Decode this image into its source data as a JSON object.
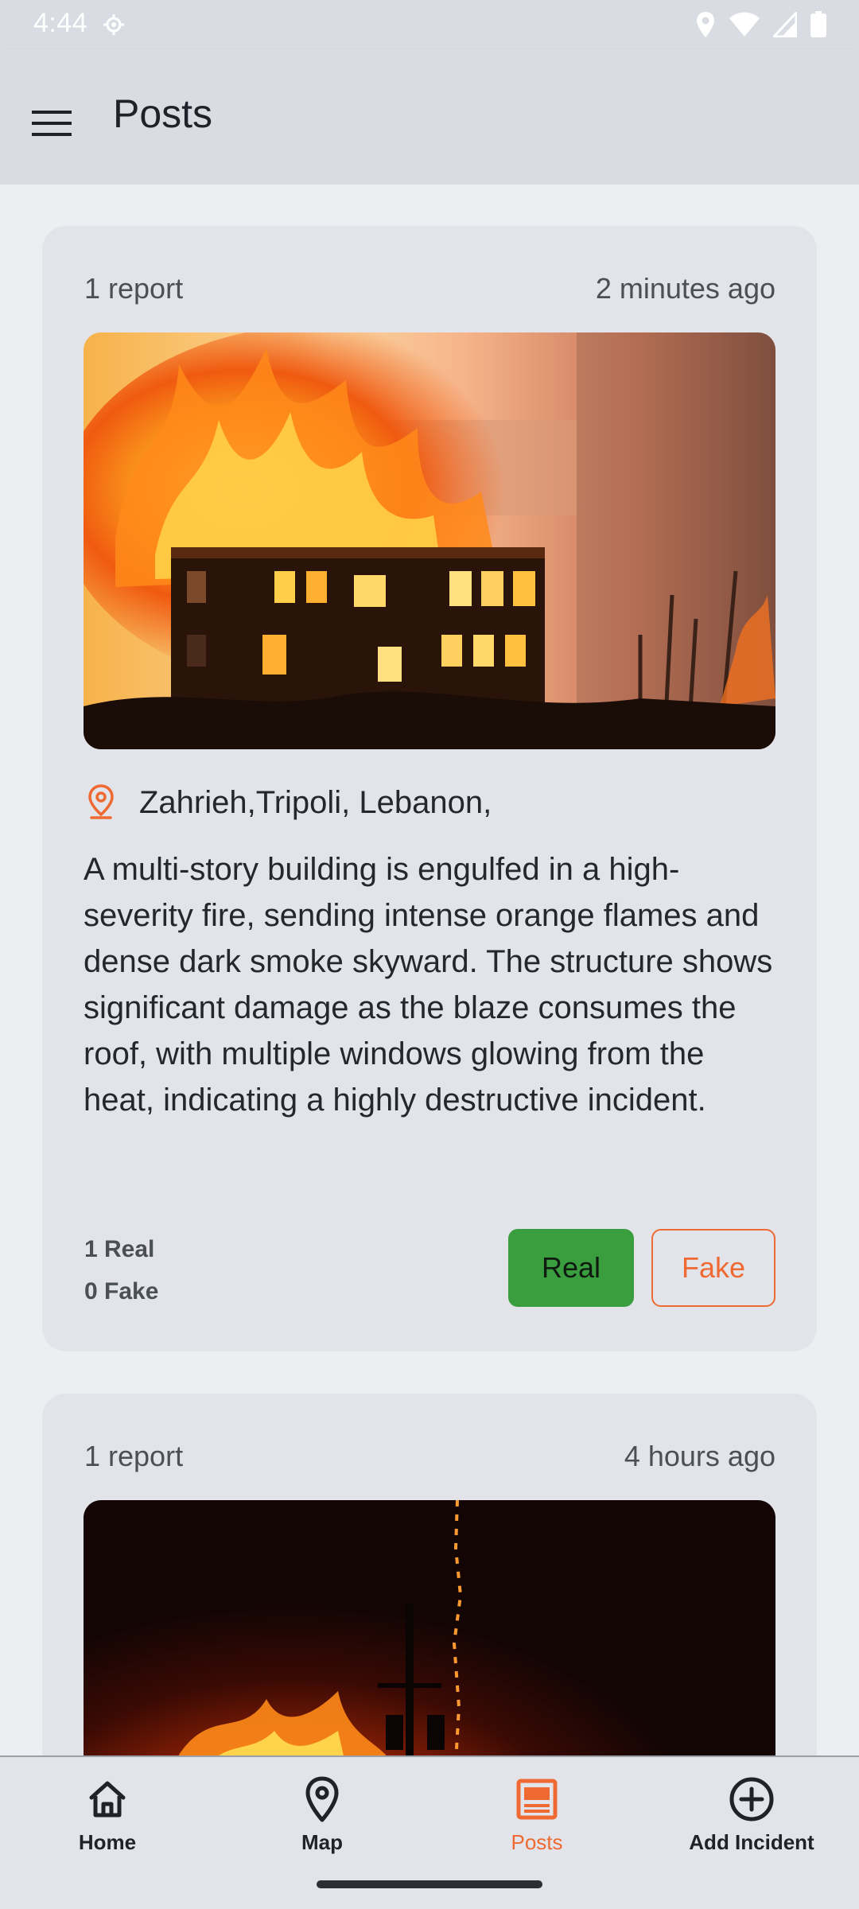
{
  "status_bar": {
    "time": "4:44",
    "icons": [
      "location-settings-icon",
      "location-icon",
      "wifi-icon",
      "signal-icon",
      "battery-icon"
    ]
  },
  "app_bar": {
    "title": "Posts",
    "menu_icon": "hamburger-menu-icon"
  },
  "colors": {
    "accent": "#ee6a32",
    "real_button": "#3a9e3f",
    "card_background": "#e2e4ea",
    "app_bar": "#d9dce3"
  },
  "posts": [
    {
      "reports": "1 report",
      "time_ago": "2 minutes ago",
      "image": "burning-building-photo",
      "location": "Zahrieh,Tripoli, Lebanon,",
      "description": "A multi-story building is engulfed in a high-severity fire, sending intense orange flames and dense dark smoke skyward. The structure shows significant damage as the blaze consumes the roof, with multiple windows glowing from the heat, indicating a highly destructive incident.",
      "real_count": "1 Real",
      "fake_count": "0 Fake",
      "real_label": "Real",
      "fake_label": "Fake"
    },
    {
      "reports": "1 report",
      "time_ago": "4 hours ago",
      "image": "night-fire-utility-pole-photo"
    }
  ],
  "bottom_nav": {
    "items": [
      {
        "label": "Home",
        "icon": "home-icon",
        "active": false
      },
      {
        "label": "Map",
        "icon": "map-pin-icon",
        "active": false
      },
      {
        "label": "Posts",
        "icon": "posts-icon",
        "active": true
      },
      {
        "label": "Add Incident",
        "icon": "add-circle-icon",
        "active": false
      }
    ]
  }
}
